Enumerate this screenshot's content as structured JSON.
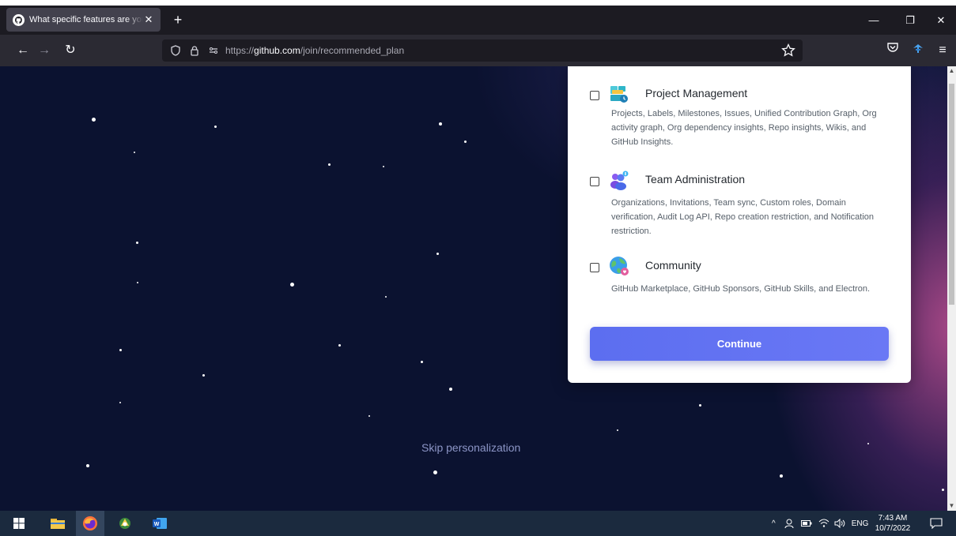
{
  "browser": {
    "tab_title": "What specific features are you i",
    "tab_close": "✕",
    "new_tab": "+",
    "url_prefix": "https://",
    "url_domain": "github.com",
    "url_path": "/join/recommended_plan",
    "window_controls": {
      "minimize": "—",
      "maximize": "❐",
      "close": "✕"
    }
  },
  "card": {
    "options": [
      {
        "title": "Project Management",
        "description": "Projects, Labels, Milestones, Issues, Unified Contribution Graph, Org activity graph, Org dependency insights, Repo insights, Wikis, and GitHub Insights.",
        "icon": "project-management-icon",
        "checked": false
      },
      {
        "title": "Team Administration",
        "description": "Organizations, Invitations, Team sync, Custom roles, Domain verification, Audit Log API, Repo creation restriction, and Notification restriction.",
        "icon": "team-administration-icon",
        "checked": false
      },
      {
        "title": "Community",
        "description": "GitHub Marketplace, GitHub Sponsors, GitHub Skills, and Electron.",
        "icon": "community-icon",
        "checked": false
      }
    ],
    "continue_label": "Continue"
  },
  "skip_label": "Skip personalization",
  "taskbar": {
    "language": "ENG",
    "time": "7:43 AM",
    "date": "10/7/2022"
  },
  "colors": {
    "accent": "#5c6ef0",
    "page_bg": "#0b1230"
  }
}
